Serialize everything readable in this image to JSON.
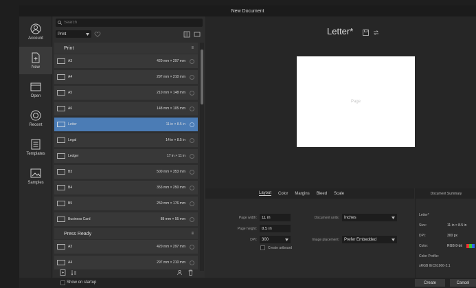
{
  "window": {
    "title": "New Document"
  },
  "sidebar": {
    "items": [
      {
        "label": "Account",
        "icon": "account-icon"
      },
      {
        "label": "New",
        "icon": "new-document-icon"
      },
      {
        "label": "Open",
        "icon": "folder-icon"
      },
      {
        "label": "Recent",
        "icon": "clock-icon"
      },
      {
        "label": "Templates",
        "icon": "templates-icon"
      },
      {
        "label": "Samples",
        "icon": "samples-icon"
      }
    ]
  },
  "search": {
    "placeholder": "Search"
  },
  "filter": {
    "value": "Print"
  },
  "presets": {
    "categories": [
      {
        "name": "Print",
        "menu": "≡",
        "items": [
          {
            "name": "A3",
            "size": "420 mm × 297 mm"
          },
          {
            "name": "A4",
            "size": "297 mm × 210 mm"
          },
          {
            "name": "A5",
            "size": "210 mm × 148 mm"
          },
          {
            "name": "A6",
            "size": "148 mm × 105 mm"
          },
          {
            "name": "Letter",
            "size": "11 in × 8.5 in"
          },
          {
            "name": "Legal",
            "size": "14 in × 8.5 in"
          },
          {
            "name": "Ledger",
            "size": "17 in × 11 in"
          },
          {
            "name": "B3",
            "size": "500 mm × 353 mm"
          },
          {
            "name": "B4",
            "size": "353 mm × 250 mm"
          },
          {
            "name": "B5",
            "size": "250 mm × 176 mm"
          },
          {
            "name": "Business Card",
            "size": "88 mm × 55 mm"
          }
        ]
      },
      {
        "name": "Press Ready",
        "menu": "≡",
        "items": [
          {
            "name": "A3",
            "size": "420 mm × 297 mm"
          },
          {
            "name": "A4",
            "size": "297 mm × 210 mm"
          }
        ]
      }
    ]
  },
  "preview": {
    "title": "Letter*",
    "page_label": "Page"
  },
  "settings": {
    "tabs": [
      "Layout",
      "Color",
      "Margins",
      "Bleed",
      "Scale"
    ],
    "page_width_label": "Page width:",
    "page_width": "11 in",
    "page_height_label": "Page height:",
    "page_height": "8.5 in",
    "dpi_label": "DPI:",
    "dpi": "300",
    "units_label": "Document units:",
    "units": "Inches",
    "placement_label": "Image placement:",
    "placement": "Prefer Embedded",
    "artboard_label": "Create artboard"
  },
  "summary": {
    "title": "Document Summary",
    "name": "Letter*",
    "size_label": "Size:",
    "size": "11 in × 8.5 in",
    "dpi_label": "DPI:",
    "dpi": "300 px",
    "color_label": "Color:",
    "color": "RGB 8-bit",
    "profile_label": "Color Profile:",
    "profile": "sRGB IEC61966-2.1"
  },
  "footer": {
    "startup_label": "Show on startup",
    "create_label": "Create",
    "cancel_label": "Cancel"
  },
  "colors": {
    "accent": "#4b7cb5",
    "background": "#2b2b2b"
  }
}
